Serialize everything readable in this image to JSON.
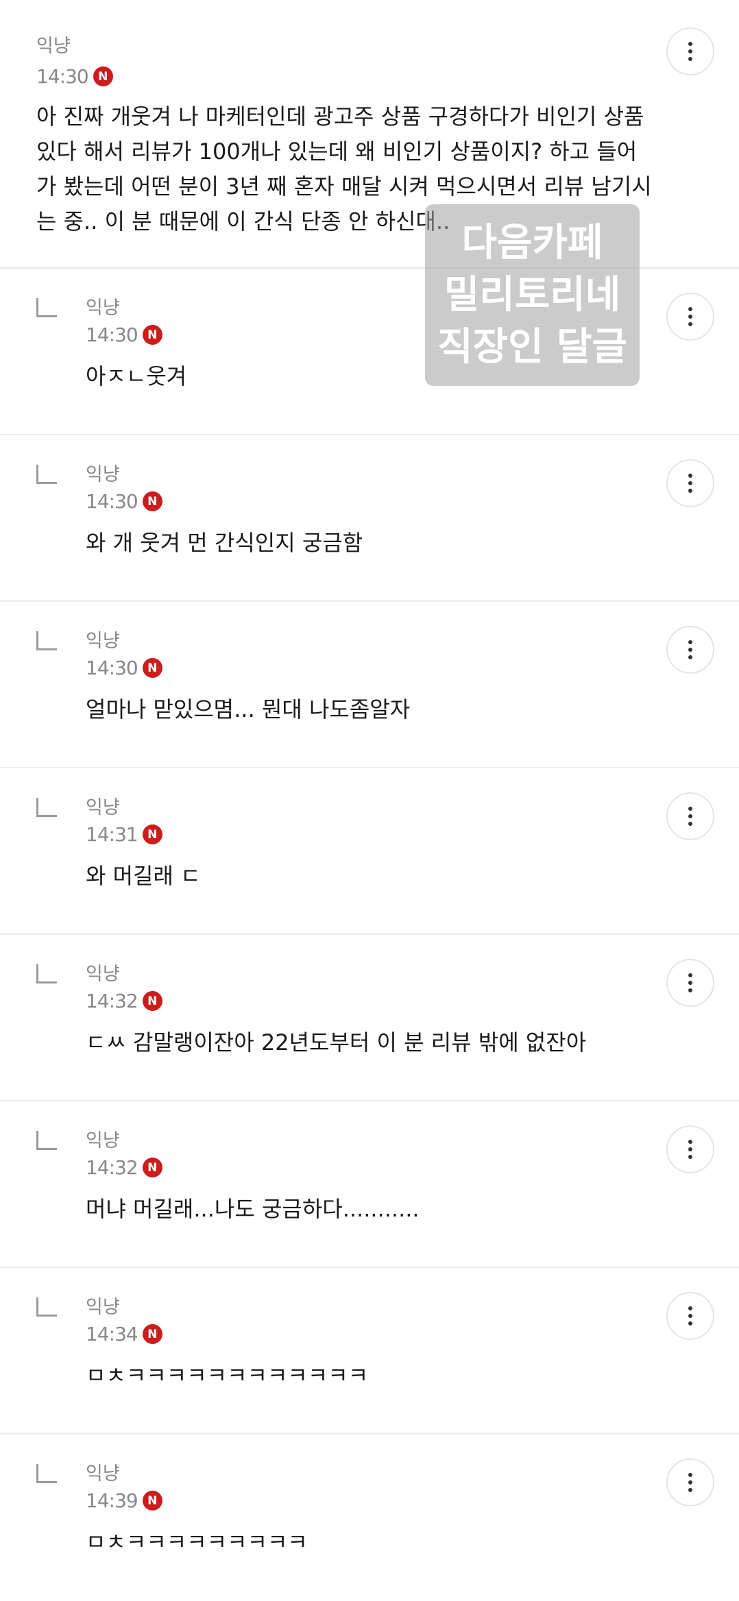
{
  "comments": [
    {
      "author": "익냥",
      "time": "14:30",
      "badge": "N",
      "text": "아 진짜 개웃겨 나 마케터인데 광고주 상품 구경하다가 비인기 상품 있다 해서 리뷰가 100개나 있는데 왜 비인기 상품이지? 하고 들어가 봤는데 어떤 분이 3년 째 혼자 매달 시켜 먹으시면서 리뷰 남기시는 중.. 이 분 때문에 이 간식 단종 안 하신대..",
      "reply": false
    },
    {
      "author": "익냥",
      "time": "14:30",
      "badge": "N",
      "text": "아ㅈㄴ웃겨",
      "reply": true
    },
    {
      "author": "익냥",
      "time": "14:30",
      "badge": "N",
      "text": "와 개 웃겨 먼 간식인지 궁금함",
      "reply": true
    },
    {
      "author": "익냥",
      "time": "14:30",
      "badge": "N",
      "text": "얼마나 맏있으몀... 뭔대 나도좀알자",
      "reply": true
    },
    {
      "author": "익냥",
      "time": "14:31",
      "badge": "N",
      "text": "와 머길래 ㄷ",
      "reply": true
    },
    {
      "author": "익냥",
      "time": "14:32",
      "badge": "N",
      "text": "ㄷㅆ 감말랭이잔아 22년도부터 이 분 리뷰 밖에 없잔아",
      "reply": true
    },
    {
      "author": "익냥",
      "time": "14:32",
      "badge": "N",
      "text": "머냐 머길래...나도 궁금하다...........",
      "reply": true
    },
    {
      "author": "익냥",
      "time": "14:34",
      "badge": "N",
      "text": "ㅁㅊㅋㅋㅋㅋㅋㅋㅋㅋㅋㅋㅋㅋ",
      "reply": true
    },
    {
      "author": "익냥",
      "time": "14:39",
      "badge": "N",
      "text": "ㅁㅊㅋㅋㅋㅋㅋㅋㅋㅋㅋ",
      "reply": true
    }
  ],
  "watermark": {
    "lines": [
      "다음카페",
      "밀리토리네",
      "직장인 달글"
    ]
  },
  "icons": {
    "more": "more-vertical-icon",
    "reply": "reply-arrow-icon",
    "new": "new-badge-icon"
  },
  "colors": {
    "badge": "#cc1c1c",
    "divider": "#ebebeb",
    "meta": "#888888"
  }
}
